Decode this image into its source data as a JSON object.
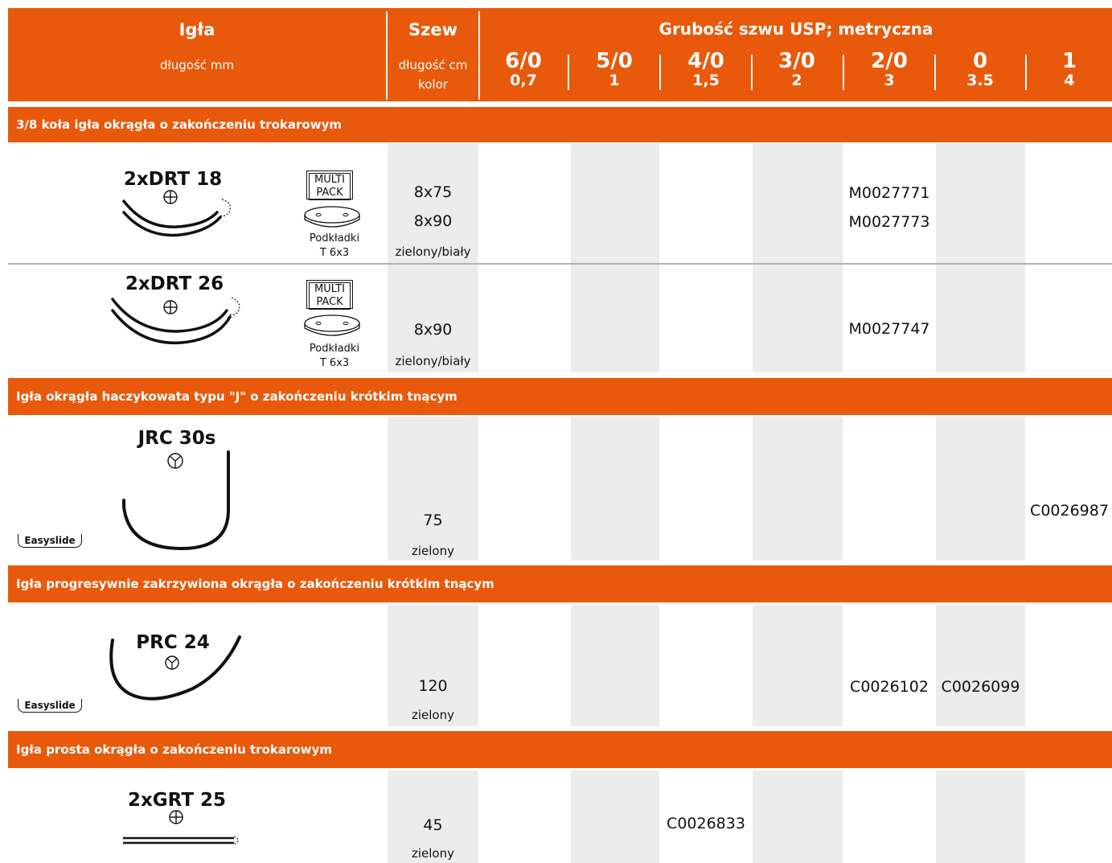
{
  "header": {
    "needle_title": "Igła",
    "needle_sub": "długość mm",
    "suture_title": "Szew",
    "suture_sub1": "długość cm",
    "suture_sub2": "kolor",
    "thickness_title": "Grubość szwu USP; metryczna",
    "sizes": [
      {
        "usp": "6/0",
        "metric": "0,7"
      },
      {
        "usp": "5/0",
        "metric": "1"
      },
      {
        "usp": "4/0",
        "metric": "1,5"
      },
      {
        "usp": "3/0",
        "metric": "2"
      },
      {
        "usp": "2/0",
        "metric": "3"
      },
      {
        "usp": "0",
        "metric": "3.5"
      },
      {
        "usp": "1",
        "metric": "4"
      }
    ]
  },
  "sections": [
    {
      "title": "3/8 koła igła okrągła o zakończeniu trokarowym"
    },
    {
      "title": "Igła okrągła haczykowata typu \"J\" o zakończeniu krótkim tnącym"
    },
    {
      "title": "Igła progresywnie zakrzywiona okrągła o zakończeniu krótkim tnącym"
    },
    {
      "title": "Igła prosta okrągła o zakończeniu trokarowym"
    }
  ],
  "rows": [
    {
      "needle": "2xDRT 18",
      "pack_line1": "MULTI",
      "pack_line2": "PACK",
      "pads_line1": "Podkładki",
      "pads_line2": "T 6x3",
      "length1": "8x75",
      "length2": "8x90",
      "color": "zielony/biały",
      "code1": "M0027771",
      "code2": "M0027773"
    },
    {
      "needle": "2xDRT 26",
      "pack_line1": "MULTI",
      "pack_line2": "PACK",
      "pads_line1": "Podkładki",
      "pads_line2": "T 6x3",
      "length1": "8x90",
      "color": "zielony/biały",
      "code1": "M0027747"
    },
    {
      "needle": "JRC 30s",
      "badge": "Easyslide",
      "length1": "75",
      "color": "zielony",
      "code1": "C0026987"
    },
    {
      "needle": "PRC 24",
      "badge": "Easyslide",
      "length1": "120",
      "color": "zielony",
      "code1": "C0026102",
      "code2": "C0026099"
    },
    {
      "needle": "2xGRT 25",
      "length1": "45",
      "color": "zielony",
      "code1": "C0026833"
    }
  ],
  "colors": {
    "accent": "#e8590c",
    "stripe": "#ececec"
  }
}
